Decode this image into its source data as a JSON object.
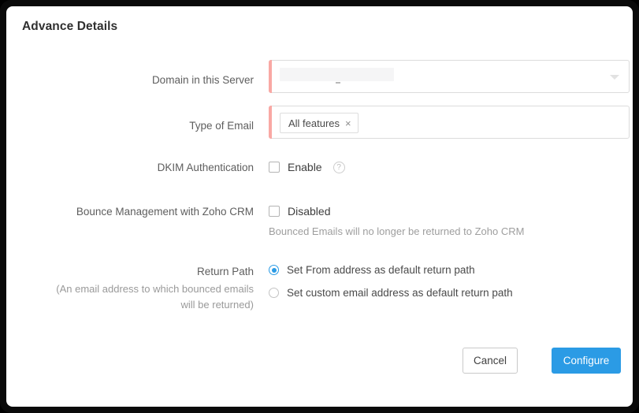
{
  "panel": {
    "title": "Advance Details"
  },
  "fields": {
    "domain": {
      "label": "Domain in this Server",
      "value": "",
      "redacted": true,
      "required": true,
      "caret_icon": "chevron-down-icon"
    },
    "type_of_email": {
      "label": "Type of Email",
      "required": true,
      "tags": [
        {
          "label": "All features",
          "remove_icon": "close-icon",
          "remove_glyph": "×"
        }
      ]
    },
    "dkim": {
      "label": "DKIM Authentication",
      "checkbox_label": "Enable",
      "checked": false,
      "help_icon": "help-icon",
      "help_glyph": "?"
    },
    "bounce": {
      "label": "Bounce Management with Zoho CRM",
      "checkbox_label": "Disabled",
      "checked": false,
      "hint": "Bounced Emails will no longer be returned to Zoho CRM"
    },
    "return_path": {
      "label": "Return Path",
      "sub_label_line1": "(An email address to which bounced emails",
      "sub_label_line2": "will be returned)",
      "options": [
        {
          "label": "Set From address as default return path",
          "selected": true
        },
        {
          "label": "Set custom email address as default return path",
          "selected": false
        }
      ]
    }
  },
  "footer": {
    "cancel_label": "Cancel",
    "configure_label": "Configure"
  },
  "colors": {
    "accent_blue": "#2b9be5",
    "required_bar": "#f9a8a4",
    "label_grey": "#5e5e5e",
    "hint_grey": "#9e9e9e"
  }
}
